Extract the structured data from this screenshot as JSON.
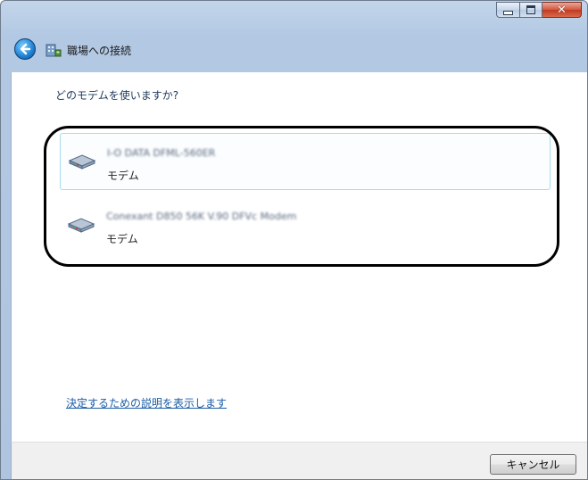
{
  "window": {
    "title": "職場への接続",
    "controls": [
      "minimize",
      "maximize",
      "close"
    ]
  },
  "content": {
    "prompt": "どのモデムを使いますか?",
    "modems": [
      {
        "name": "I-O DATA DFML-560ER",
        "type": "モデム",
        "selected": true,
        "icon": "modem-icon"
      },
      {
        "name": "Conexant D850 56K V.90 DFVc Modem",
        "type": "モデム",
        "selected": false,
        "icon": "modem-icon"
      }
    ],
    "help_link": "決定するための説明を表示します"
  },
  "footer": {
    "cancel_label": "キャンセル"
  },
  "colors": {
    "frame": "#b2c8e3",
    "link": "#1a5da6",
    "prompt": "#1e395b",
    "selection_border": "#a6dcef",
    "close_button": "#c13a1f"
  }
}
